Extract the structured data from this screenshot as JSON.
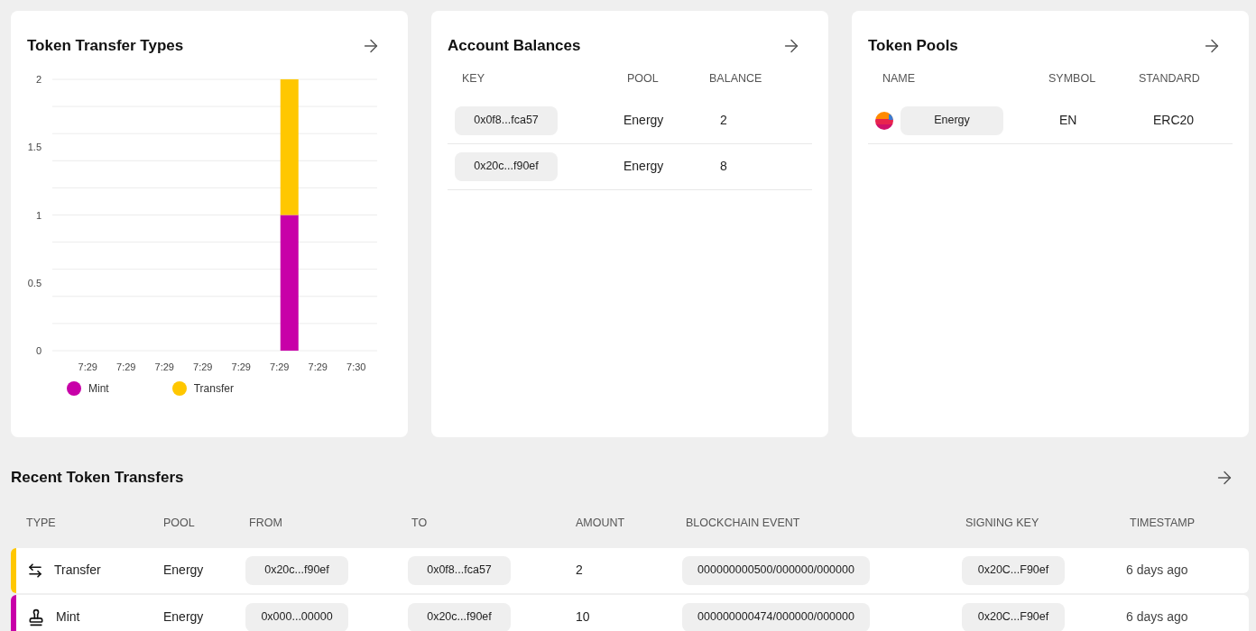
{
  "cards": [
    {
      "kind": "chart",
      "title": "Token Transfer Types",
      "chart_data": {
        "type": "bar",
        "stacked": true,
        "categories": [
          "7:29",
          "7:29",
          "7:29",
          "7:29",
          "7:29",
          "7:29",
          "7:29",
          "7:30"
        ],
        "series": [
          {
            "name": "Mint",
            "color": "#c800a8",
            "values": [
              0,
              0,
              0,
              0,
              0,
              1,
              0,
              0
            ]
          },
          {
            "name": "Transfer",
            "color": "#ffc700",
            "values": [
              0,
              0,
              0,
              0,
              0,
              1,
              0,
              0
            ]
          }
        ],
        "ylim": [
          0,
          2
        ],
        "yticks": [
          0,
          0.5,
          1,
          1.5,
          2
        ]
      }
    },
    {
      "kind": "balances",
      "title": "Account Balances",
      "columns": [
        "KEY",
        "POOL",
        "BALANCE"
      ],
      "rows": [
        {
          "key": "0x0f8...fca57",
          "pool": "Energy",
          "balance": "2"
        },
        {
          "key": "0x20c...f90ef",
          "pool": "Energy",
          "balance": "8"
        }
      ]
    },
    {
      "kind": "pools",
      "title": "Token Pools",
      "columns": [
        "NAME",
        "SYMBOL",
        "STANDARD"
      ],
      "rows": [
        {
          "name": "Energy",
          "symbol": "EN",
          "standard": "ERC20"
        }
      ]
    }
  ],
  "transfers": {
    "title": "Recent Token Transfers",
    "columns": [
      "TYPE",
      "POOL",
      "FROM",
      "TO",
      "AMOUNT",
      "BLOCKCHAIN EVENT",
      "SIGNING KEY",
      "TIMESTAMP"
    ],
    "rows": [
      {
        "kind": "transfer",
        "color": "#ffc700",
        "type": "Transfer",
        "pool": "Energy",
        "from": "0x20c...f90ef",
        "to": "0x0f8...fca57",
        "amount": "2",
        "event": "000000000500/000000/000000",
        "signing_key": "0x20C...F90ef",
        "timestamp": "6 days ago"
      },
      {
        "kind": "mint",
        "color": "#c800a8",
        "type": "Mint",
        "pool": "Energy",
        "from": "0x000...00000",
        "to": "0x20c...f90ef",
        "amount": "10",
        "event": "000000000474/000000/000000",
        "signing_key": "0x20C...F90ef",
        "timestamp": "6 days ago"
      }
    ]
  }
}
